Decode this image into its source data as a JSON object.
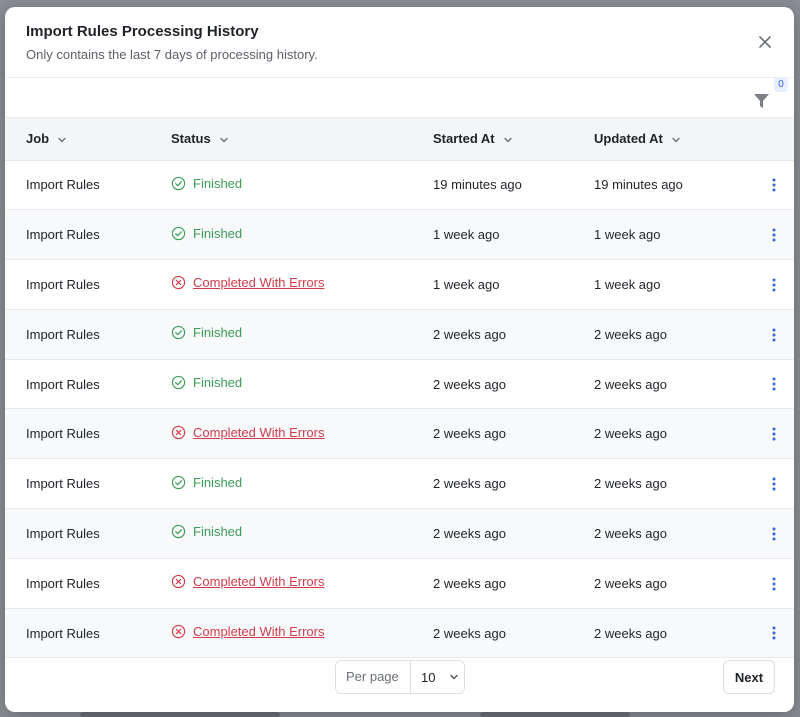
{
  "modal": {
    "title": "Import Rules Processing History",
    "subtitle": "Only contains the last 7 days of processing history."
  },
  "filter": {
    "count": "0",
    "icon": "filter-icon"
  },
  "table": {
    "columns": [
      "Job",
      "Status",
      "Started At",
      "Updated At"
    ],
    "rows": [
      {
        "job": "Import Rules",
        "status": "Finished",
        "started": "19 minutes ago",
        "updated": "19 minutes ago"
      },
      {
        "job": "Import Rules",
        "status": "Finished",
        "started": "1 week ago",
        "updated": "1 week ago"
      },
      {
        "job": "Import Rules",
        "status": "Completed With Errors",
        "started": "1 week ago",
        "updated": "1 week ago"
      },
      {
        "job": "Import Rules",
        "status": "Finished",
        "started": "2 weeks ago",
        "updated": "2 weeks ago"
      },
      {
        "job": "Import Rules",
        "status": "Finished",
        "started": "2 weeks ago",
        "updated": "2 weeks ago"
      },
      {
        "job": "Import Rules",
        "status": "Completed With Errors",
        "started": "2 weeks ago",
        "updated": "2 weeks ago"
      },
      {
        "job": "Import Rules",
        "status": "Finished",
        "started": "2 weeks ago",
        "updated": "2 weeks ago"
      },
      {
        "job": "Import Rules",
        "status": "Finished",
        "started": "2 weeks ago",
        "updated": "2 weeks ago"
      },
      {
        "job": "Import Rules",
        "status": "Completed With Errors",
        "started": "2 weeks ago",
        "updated": "2 weeks ago"
      },
      {
        "job": "Import Rules",
        "status": "Completed With Errors",
        "started": "2 weeks ago",
        "updated": "2 weeks ago"
      }
    ]
  },
  "pagination": {
    "per_page_label": "Per page",
    "per_page_value": "10",
    "next_label": "Next"
  },
  "colors": {
    "success": "#3b9c57",
    "error": "#d23b4b",
    "accent": "#3566d6"
  }
}
